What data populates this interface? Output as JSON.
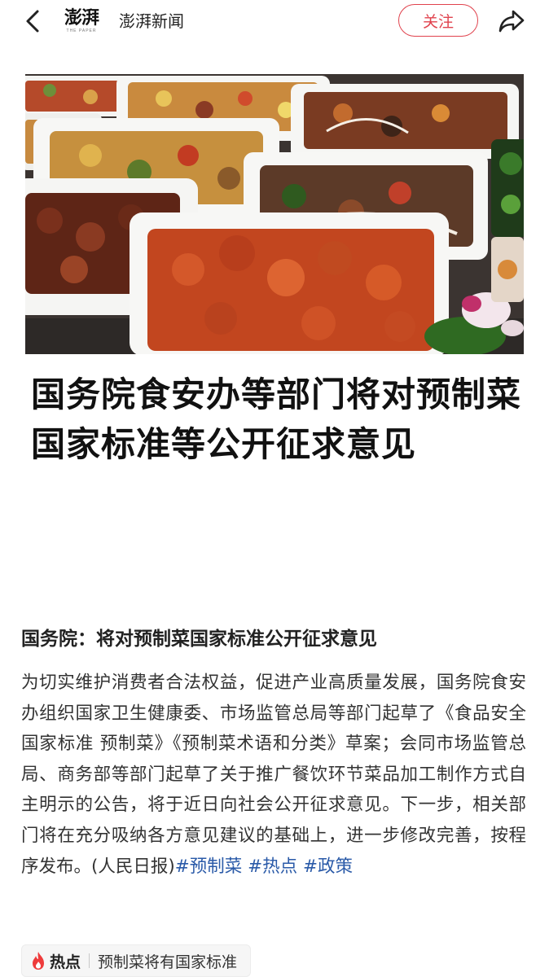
{
  "header": {
    "logo_text": "澎湃",
    "logo_subtext": "THE PAPER",
    "source_name": "澎湃新闻",
    "follow_label": "关注",
    "icons": {
      "back": "chevron-left-icon",
      "share": "share-arrow-icon"
    },
    "accent_color": "#e0424d"
  },
  "article": {
    "headline": "国务院食安办等部门将对预制菜国家标准等公开征求意见"
  },
  "post": {
    "title": "国务院：将对预制菜国家标准公开征求意见",
    "body": "为切实维护消费者合法权益，促进产业高质量发展，国务院食安办组织国家卫生健康委、市场监管总局等部门起草了《食品安全国家标准 预制菜》《预制菜术语和分类》草案；会同市场监管总局、商务部等部门起草了关于推广餐饮环节菜品加工制作方式自主明示的公告，将于近日向社会公开征求意见。下一步，相关部门将在充分吸纳各方意见建议的基础上，进一步修改完善，按程序发布。(人民日报)",
    "hashtags": [
      "#预制菜",
      "#热点",
      "#政策"
    ],
    "hashtag_color": "#2a5aa8"
  },
  "hot_chip": {
    "label": "热点",
    "topic": "预制菜将有国家标准",
    "icon": "flame-icon"
  }
}
